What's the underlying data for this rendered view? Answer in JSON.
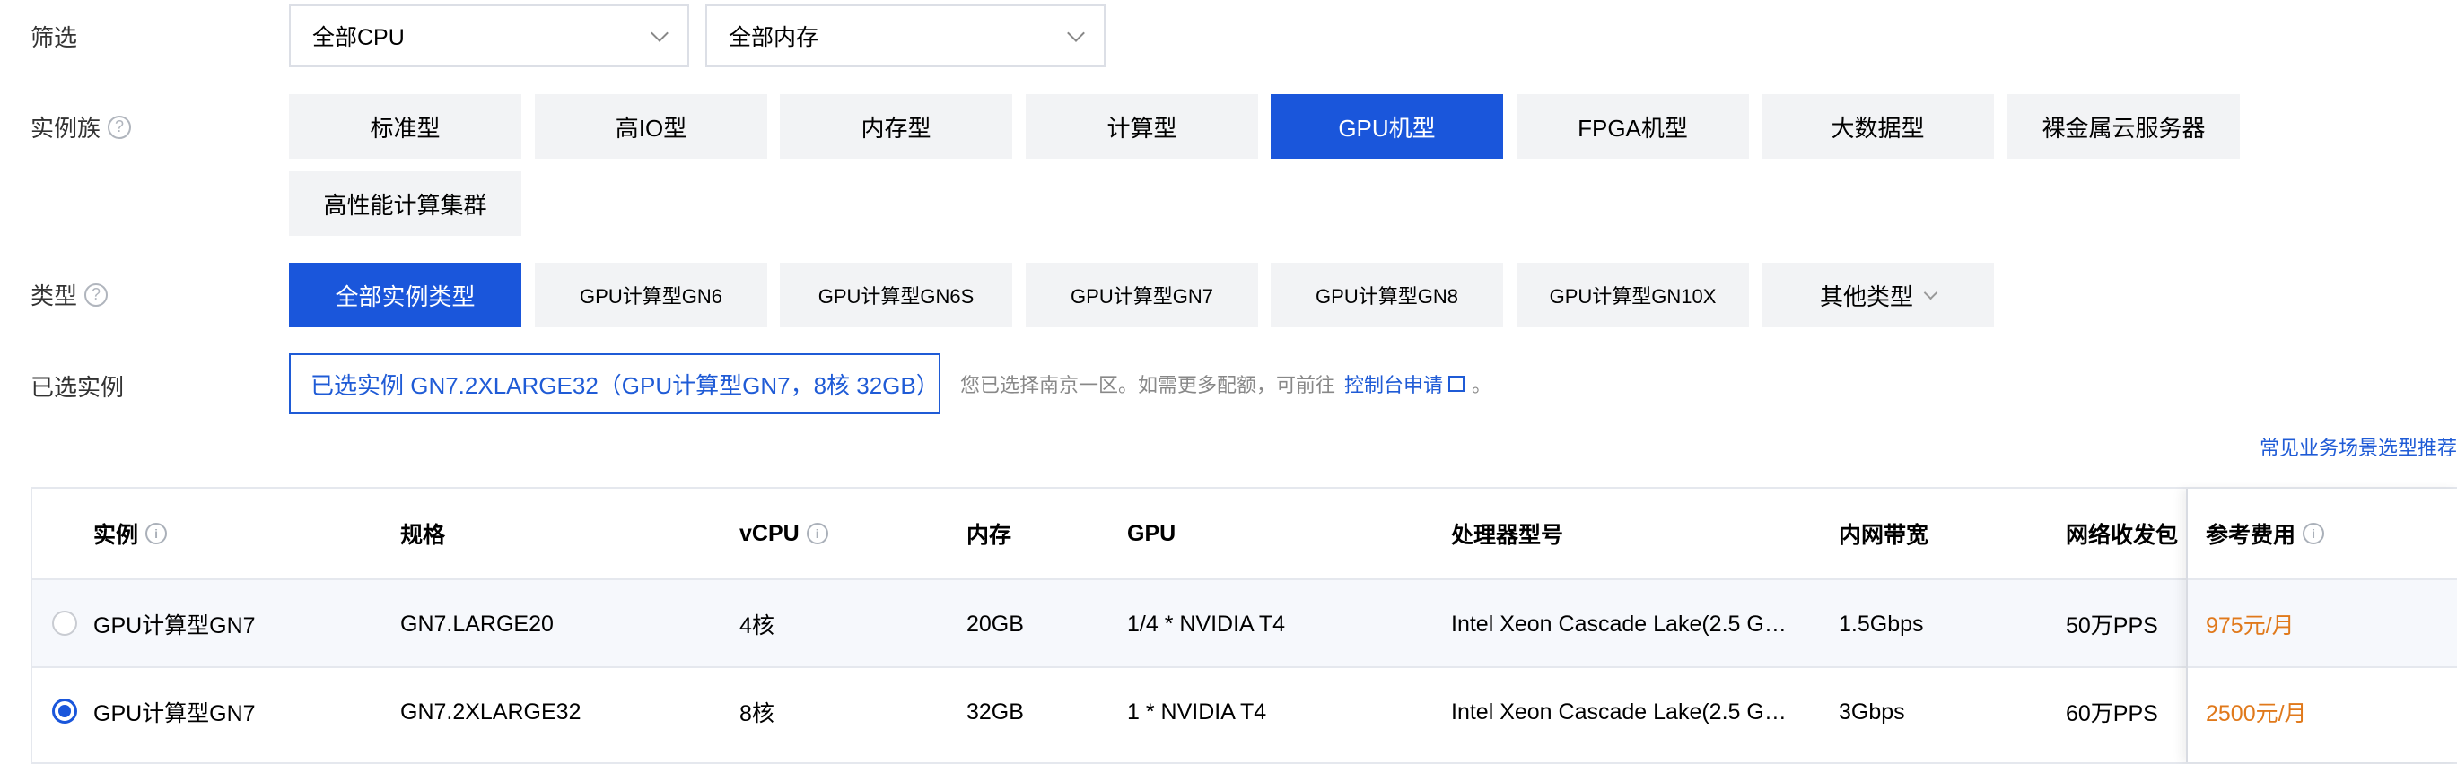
{
  "filter": {
    "label": "筛选",
    "cpu_select": "全部CPU",
    "memory_select": "全部内存"
  },
  "family": {
    "label": "实例族",
    "help_icon": "?",
    "options": [
      "标准型",
      "高IO型",
      "内存型",
      "计算型",
      "GPU机型",
      "FPGA机型",
      "大数据型",
      "裸金属云服务器",
      "高性能计算集群"
    ],
    "selected": "GPU机型"
  },
  "type": {
    "label": "类型",
    "help_icon": "?",
    "options": [
      "全部实例类型",
      "GPU计算型GN6",
      "GPU计算型GN6S",
      "GPU计算型GN7",
      "GPU计算型GN8",
      "GPU计算型GN10X",
      "其他类型"
    ],
    "selected": "全部实例类型"
  },
  "selected_instance": {
    "label": "已选实例",
    "value": "已选实例 GN7.2XLARGE32（GPU计算型GN7，8核 32GB）",
    "hint": "您已选择南京一区。如需更多配额，可前往",
    "hint_link": "控制台申请",
    "hint_end": "。"
  },
  "scenario_link": "常见业务场景选型推荐",
  "table": {
    "headers": [
      "实例",
      "规格",
      "vCPU",
      "内存",
      "GPU",
      "处理器型号",
      "内网带宽",
      "网络收发包",
      "参考费用"
    ],
    "rows": [
      {
        "instance": "GPU计算型GN7",
        "spec": "GN7.LARGE20",
        "vcpu": "4核",
        "memory": "20GB",
        "gpu": "1/4 * NVIDIA T4",
        "cpu_model": "Intel Xeon Cascade Lake(2.5 G…",
        "bandwidth": "1.5Gbps",
        "pps": "50万PPS",
        "price": "975元/月",
        "selected": false
      },
      {
        "instance": "GPU计算型GN7",
        "spec": "GN7.2XLARGE32",
        "vcpu": "8核",
        "memory": "32GB",
        "gpu": "1 * NVIDIA T4",
        "cpu_model": "Intel Xeon Cascade Lake(2.5 G…",
        "bandwidth": "3Gbps",
        "pps": "60万PPS",
        "price": "2500元/月",
        "selected": true
      }
    ]
  },
  "colors": {
    "primary": "#1a56db",
    "price": "#e0791b",
    "chip_bg": "#f2f3f5"
  }
}
